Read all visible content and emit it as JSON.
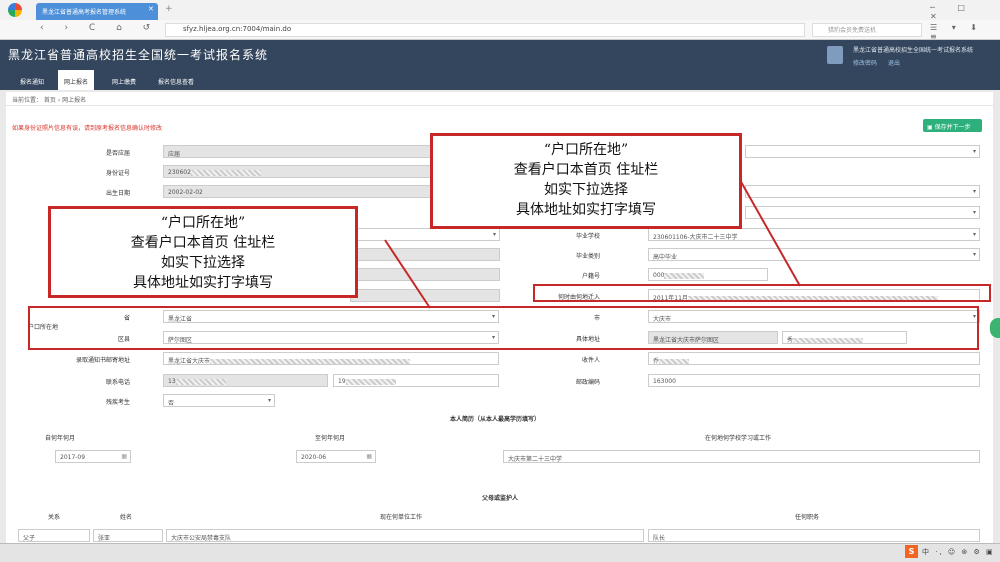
{
  "browser": {
    "tab_title": "黑龙江省普通高考报名管理系统",
    "nav_icons": "‹ › C ⌂ ↺ ☆",
    "url": "sfyz.hljea.org.cn:7004/main.do",
    "search_placeholder": "猎豹会员免费送机",
    "window_controls": "─ □ ✕",
    "right_icons": "☰ ▾ ⬇ ≡"
  },
  "site": {
    "title": "黑龙江省普通高校招生全国统一考试报名系统",
    "system_name": "黑龙江省普通高校招生全国统一考试报名系统",
    "modify_password": "修改密码",
    "logout": "退出",
    "nav": [
      "报名通知",
      "网上报名",
      "网上缴费",
      "报名信息查看"
    ]
  },
  "breadcrumb": "当前位置：  首页  ›  网上报名",
  "notice": "如果身份证照片信息有误，请到原考报名信息确认时修改",
  "save_button": "保存并下一步",
  "form": {
    "is_repeat_label": "是否应届",
    "is_repeat_value": "应届",
    "id_label": "身份证号",
    "id_value": "230602",
    "birth_label": "出生日期",
    "birth_value": "2002-02-02",
    "school_label": "毕业学校",
    "school_value": "230601106-大庆市二十三中学",
    "grad_type_label": "毕业类别",
    "grad_type_value": "高中毕业",
    "hukou_no_label": "户籍号",
    "hukou_no_value": "000",
    "move_time_label": "何时由何地迁入",
    "move_time_value": "2011年11月",
    "hukou_label": "户口所在地",
    "province_label": "省",
    "province_value": "黑龙江省",
    "city_label": "市",
    "city_value": "大庆市",
    "district_label": "区县",
    "district_value": "萨尔图区",
    "addr_label": "具体地址",
    "addr_prefix": "黑龙江省大庆市萨尔图区",
    "addr_value": "秀",
    "mail_addr_label": "录取通知书邮寄地址",
    "mail_addr_value": "黑龙江省大庆市",
    "recipient_label": "收件人",
    "recipient_value": "乔",
    "phone_label": "联系电话",
    "phone1_value": "13",
    "phone2_value": "19",
    "zip_label": "邮政编码",
    "zip_value": "163000",
    "disabled_label": "残疾考生",
    "disabled_value": "否"
  },
  "resume": {
    "title": "本人简历（从本人最高学历填写）",
    "col_from": "自何年何月",
    "col_to": "至何年何月",
    "col_where": "在何地何学校学习或工作",
    "from": "2017-09",
    "to": "2020-06",
    "where": "大庆市第二十三中学"
  },
  "parents": {
    "title": "父母或监护人",
    "col_rel": "关系",
    "col_name": "姓名",
    "col_unit": "现在何单位工作",
    "col_duty": "任何职务",
    "rel": "父子",
    "name": "张亚",
    "unit": "大庆市公安局禁毒支队",
    "duty": "队长"
  },
  "callouts": {
    "big": [
      "“户口所在地”",
      "查看户口本首页  住址栏",
      "如实下拉选择",
      "具体地址如实打字填写"
    ],
    "small": [
      "“户口所在地”",
      "查看户口本首页  住址栏",
      "如实下拉选择",
      "具体地址如实打字填写"
    ]
  },
  "taskbar": {
    "ime": "S",
    "tray": "中 ·, ☺ ⊛ ⚙ ▣"
  },
  "colors": {
    "header": "#34465d",
    "accent_tab": "#4d8fd8",
    "save_button": "#2db07b",
    "annotation_red": "#c62828",
    "notice_red": "#d9342b"
  }
}
